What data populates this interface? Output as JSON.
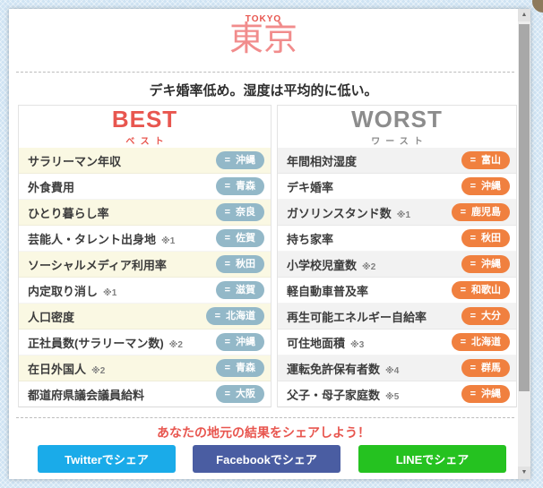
{
  "header": {
    "title_en": "TOKYO",
    "title_jp": "東京",
    "subtitle": "デキ婚率低め。湿度は平均的に低い。"
  },
  "badge_icon": "=",
  "best": {
    "title": "BEST",
    "title_kana": "ベスト",
    "rows": [
      {
        "label": "サラリーマン年収",
        "note": "",
        "pref": "沖縄"
      },
      {
        "label": "外食費用",
        "note": "",
        "pref": "青森"
      },
      {
        "label": "ひとり暮らし率",
        "note": "",
        "pref": "奈良"
      },
      {
        "label": "芸能人・タレント出身地",
        "note": "※1",
        "pref": "佐賀"
      },
      {
        "label": "ソーシャルメディア利用率",
        "note": "",
        "pref": "秋田"
      },
      {
        "label": "内定取り消し",
        "note": "※1",
        "pref": "滋賀"
      },
      {
        "label": "人口密度",
        "note": "",
        "pref": "北海道"
      },
      {
        "label": "正社員数(サラリーマン数)",
        "note": "※2",
        "pref": "沖縄"
      },
      {
        "label": "在日外国人",
        "note": "※2",
        "pref": "青森"
      },
      {
        "label": "都道府県議会議員給料",
        "note": "",
        "pref": "大阪"
      }
    ]
  },
  "worst": {
    "title": "WORST",
    "title_kana": "ワースト",
    "rows": [
      {
        "label": "年間相対湿度",
        "note": "",
        "pref": "富山"
      },
      {
        "label": "デキ婚率",
        "note": "",
        "pref": "沖縄"
      },
      {
        "label": "ガソリンスタンド数",
        "note": "※1",
        "pref": "鹿児島"
      },
      {
        "label": "持ち家率",
        "note": "",
        "pref": "秋田"
      },
      {
        "label": "小学校児童数",
        "note": "※2",
        "pref": "沖縄"
      },
      {
        "label": "軽自動車普及率",
        "note": "",
        "pref": "和歌山"
      },
      {
        "label": "再生可能エネルギー自給率",
        "note": "",
        "pref": "大分"
      },
      {
        "label": "可住地面積",
        "note": "※3",
        "pref": "北海道"
      },
      {
        "label": "運転免許保有者数",
        "note": "※4",
        "pref": "群馬"
      },
      {
        "label": "父子・母子家庭数",
        "note": "※5",
        "pref": "沖縄"
      }
    ]
  },
  "share": {
    "heading": "あなたの地元の結果をシェアしよう！",
    "buttons": [
      {
        "label": "Twitterでシェア",
        "color": "#1aabe9"
      },
      {
        "label": "Facebookでシェア",
        "color": "#4a5da2"
      },
      {
        "label": "LINEでシェア",
        "color": "#25c220"
      }
    ]
  },
  "scrollbar": {
    "up_icon": "▲",
    "down_icon": "▼"
  },
  "colors": {
    "accent_red": "#e8564f",
    "title_pink": "#f18c8c",
    "worst_title": "#8c8c8c",
    "best_badge": "#93b8c8",
    "worst_badge": "#f0803f",
    "best_row": "#faf8e3",
    "worst_row": "#f2f2f2"
  }
}
